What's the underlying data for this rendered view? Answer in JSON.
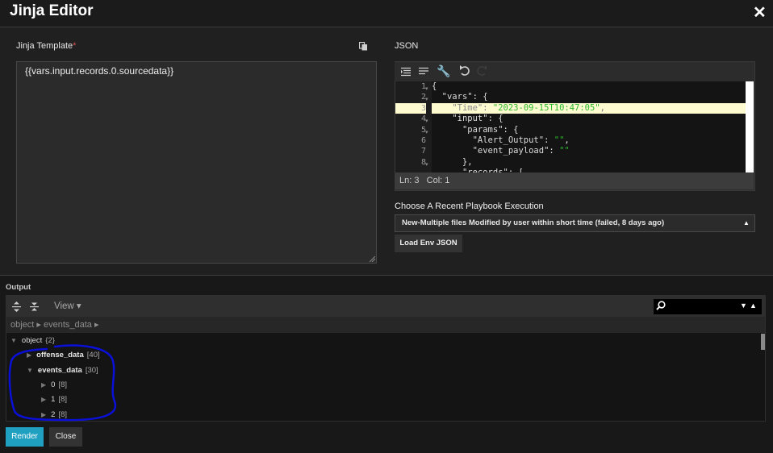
{
  "dialog": {
    "title": "Jinja Editor"
  },
  "template": {
    "label": "Jinja Template",
    "required_mark": "*",
    "value": "{{vars.input.records.0.sourcedata}}"
  },
  "json_panel": {
    "label": "JSON",
    "gutter": [
      "1",
      "2",
      "3",
      "4",
      "5",
      "6",
      "7",
      "8"
    ],
    "status": {
      "ln": "Ln: 3",
      "col": "Col: 1"
    }
  },
  "playbook": {
    "label": "Choose A Recent Playbook Execution",
    "selected": "New-Multiple files Modified by user within short time (failed, 8 days ago)",
    "load_button": "Load Env JSON"
  },
  "output": {
    "label": "Output",
    "view_label": "View ▾",
    "breadcrumb": "object ▸ events_data ▸",
    "tree": [
      {
        "key": "object",
        "count": "{2}"
      },
      {
        "key": "offense_data",
        "count": "[40]"
      },
      {
        "key": "events_data",
        "count": "[30]"
      },
      {
        "key": "0",
        "count": "[8]"
      },
      {
        "key": "1",
        "count": "[8]"
      },
      {
        "key": "2",
        "count": "[8]"
      }
    ]
  },
  "buttons": {
    "render": "Render",
    "close": "Close"
  },
  "annotation_color": "#0a10d8",
  "accent_color": "#1fa0c1"
}
